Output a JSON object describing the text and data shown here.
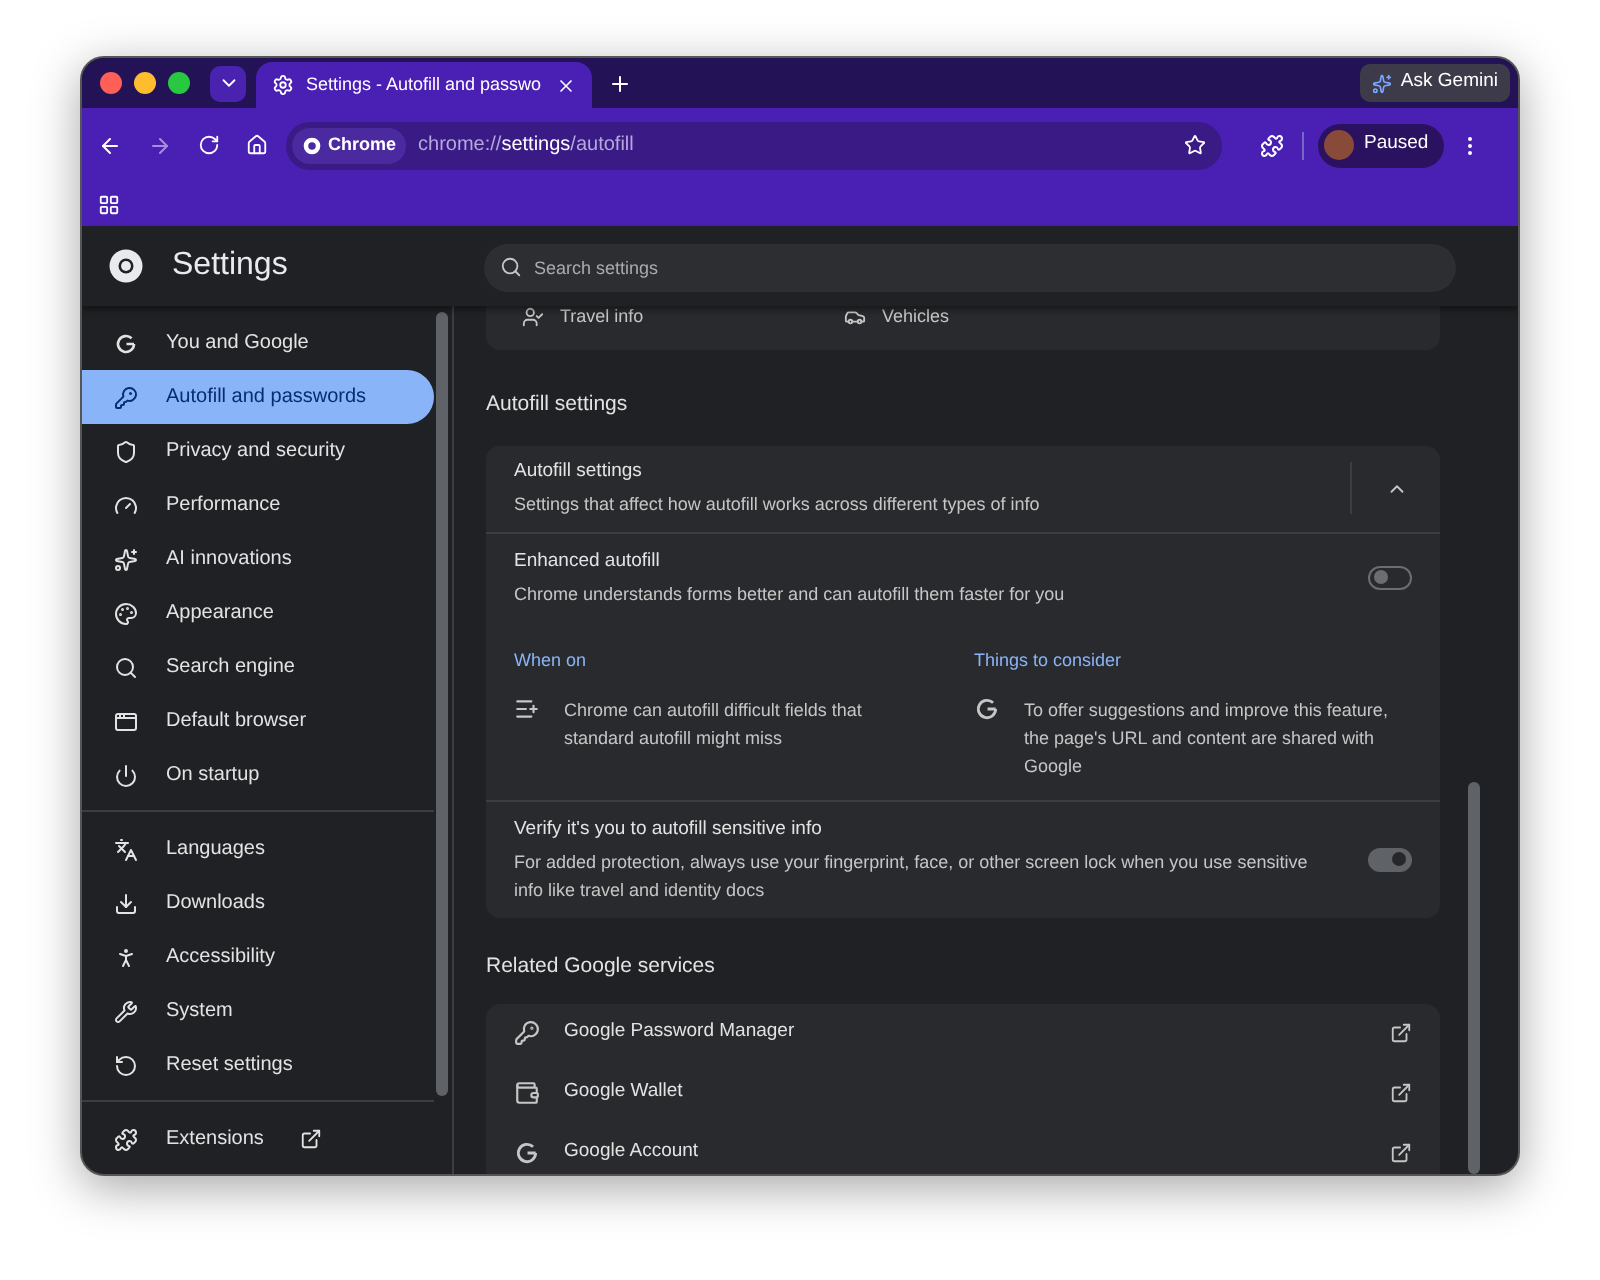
{
  "browser": {
    "tab": {
      "title": "Settings - Autofill and passwo"
    },
    "ask_button": "Ask Gemini",
    "chip": "Chrome",
    "url": {
      "scheme": "chrome://",
      "host": "settings",
      "path": "/autofill"
    },
    "profile": "Paused"
  },
  "header": {
    "title": "Settings",
    "search": {
      "placeholder": "Search settings"
    }
  },
  "sidebar": {
    "groups": [
      [
        {
          "label": "You and Google",
          "selected": false
        },
        {
          "label": "Autofill and passwords",
          "selected": true
        },
        {
          "label": "Privacy and security",
          "selected": false
        },
        {
          "label": "Performance",
          "selected": false
        },
        {
          "label": "AI innovations",
          "selected": false
        },
        {
          "label": "Appearance",
          "selected": false
        },
        {
          "label": "Search engine",
          "selected": false
        },
        {
          "label": "Default browser",
          "selected": false
        },
        {
          "label": "On startup",
          "selected": false
        }
      ],
      [
        {
          "label": "Languages",
          "selected": false
        },
        {
          "label": "Downloads",
          "selected": false
        },
        {
          "label": "Accessibility",
          "selected": false
        },
        {
          "label": "System",
          "selected": false
        },
        {
          "label": "Reset settings",
          "selected": false
        }
      ],
      [
        {
          "label": "Extensions",
          "selected": false
        }
      ]
    ]
  },
  "top_card": {
    "items": [
      {
        "label": "Travel info"
      },
      {
        "label": "Vehicles"
      }
    ]
  },
  "autofill_section": {
    "heading": "Autofill settings",
    "card": {
      "title": "Autofill settings",
      "subtitle": "Settings that affect how autofill works across different types of info",
      "expanded": true
    },
    "rows": [
      {
        "title": "Enhanced autofill",
        "subtitle": "Chrome understands forms better and can autofill them faster for you",
        "on": false,
        "details": [
          {
            "heading": "When on",
            "text": "Chrome can autofill difficult fields that standard autofill might miss"
          },
          {
            "heading": "Things to consider",
            "text": "To offer suggestions and improve this feature, the page's URL and content are shared with Google"
          }
        ]
      },
      {
        "title": "Verify it's you to autofill sensitive info",
        "subtitle": "For added protection, always use your fingerprint, face, or other screen lock when you use sensitive info like travel and identity docs",
        "on": true
      }
    ]
  },
  "related_section": {
    "heading": "Related Google services",
    "items": [
      {
        "label": "Google Password Manager"
      },
      {
        "label": "Google Wallet"
      },
      {
        "label": "Google Account"
      }
    ]
  }
}
